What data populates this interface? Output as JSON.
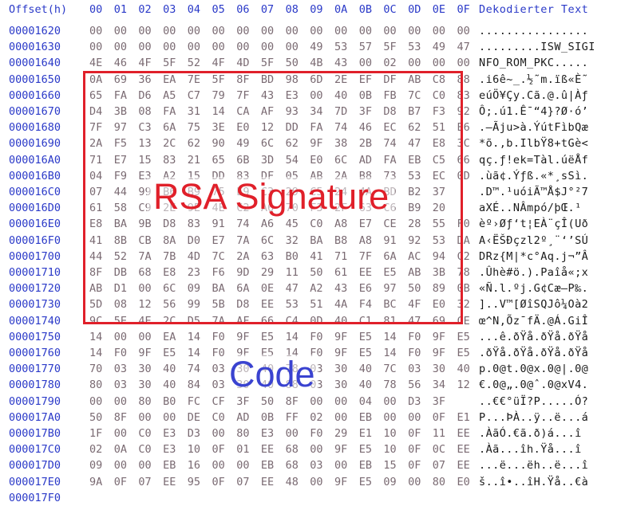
{
  "header": {
    "offset_label": "Offset(h)",
    "columns": [
      "00",
      "01",
      "02",
      "03",
      "04",
      "05",
      "06",
      "07",
      "08",
      "09",
      "0A",
      "0B",
      "0C",
      "0D",
      "0E",
      "0F"
    ],
    "decoded_label": "Dekodierter Text"
  },
  "rows": [
    {
      "offset": "00001620",
      "hex": [
        "00",
        "00",
        "00",
        "00",
        "00",
        "00",
        "00",
        "00",
        "00",
        "00",
        "00",
        "00",
        "00",
        "00",
        "00",
        "00"
      ],
      "ascii": "................"
    },
    {
      "offset": "00001630",
      "hex": [
        "00",
        "00",
        "00",
        "00",
        "00",
        "00",
        "00",
        "00",
        "00",
        "49",
        "53",
        "57",
        "5F",
        "53",
        "49",
        "47",
        "49"
      ],
      "ascii": ".........ISW_SIGI"
    },
    {
      "offset": "00001640",
      "hex": [
        "4E",
        "46",
        "4F",
        "5F",
        "52",
        "4F",
        "4D",
        "5F",
        "50",
        "4B",
        "43",
        "00",
        "02",
        "00",
        "00",
        "00"
      ],
      "ascii": "NFO_ROM_PKC....."
    },
    {
      "offset": "00001650",
      "hex": [
        "0A",
        "69",
        "36",
        "EA",
        "7E",
        "5F",
        "8F",
        "BD",
        "98",
        "6D",
        "2E",
        "EF",
        "DF",
        "AB",
        "C8",
        "88"
      ],
      "ascii": ".i6ê~_.½˜m.ïß«È˜"
    },
    {
      "offset": "00001660",
      "hex": [
        "65",
        "FA",
        "D6",
        "A5",
        "C7",
        "79",
        "7F",
        "43",
        "E3",
        "00",
        "40",
        "0B",
        "FB",
        "7C",
        "C0",
        "83"
      ],
      "ascii": "eúÖ¥Çy.Cã.@.û|Àƒ"
    },
    {
      "offset": "00001670",
      "hex": [
        "D4",
        "3B",
        "08",
        "FA",
        "31",
        "14",
        "CA",
        "AF",
        "93",
        "34",
        "7D",
        "3F",
        "D8",
        "B7",
        "F3",
        "92"
      ],
      "ascii": "Ô;.ú1.Ê¯“4}?Ø·ó’"
    },
    {
      "offset": "00001680",
      "hex": [
        "7F",
        "97",
        "C3",
        "6A",
        "75",
        "3E",
        "E0",
        "12",
        "DD",
        "FA",
        "74",
        "46",
        "EC",
        "62",
        "51",
        "E6"
      ],
      "ascii": ".—Ãju>à.ÝútFìbQæ"
    },
    {
      "offset": "00001690",
      "hex": [
        "2A",
        "F5",
        "13",
        "2C",
        "62",
        "90",
        "49",
        "6C",
        "62",
        "9F",
        "38",
        "2B",
        "74",
        "47",
        "E8",
        "3C"
      ],
      "ascii": "*õ.,b.IlbŸ8+tGè<"
    },
    {
      "offset": "000016A0",
      "hex": [
        "71",
        "E7",
        "15",
        "83",
        "21",
        "65",
        "6B",
        "3D",
        "54",
        "E0",
        "6C",
        "AD",
        "FA",
        "EB",
        "C5",
        "66"
      ],
      "ascii": "qç.ƒ!ek=Tàl.úëÅf"
    },
    {
      "offset": "000016B0",
      "hex": [
        "04",
        "F9",
        "E3",
        "A2",
        "15",
        "DD",
        "83",
        "DF",
        "05",
        "AB",
        "2A",
        "B8",
        "73",
        "53",
        "EC",
        "0D"
      ],
      "ascii": ".ùã¢.Ýƒß.«*¸sSì."
    },
    {
      "offset": "000016C0",
      "hex": [
        "07",
        "44",
        "99",
        "B6",
        "B9",
        "75",
        "E9",
        "C3",
        "29",
        "C5",
        "24",
        "4A",
        "BD",
        "B2",
        "37"
      ],
      "ascii": ".D™.¹uóiÃ™Å$J°²7"
    },
    {
      "offset": "000016D0",
      "hex": [
        "61",
        "58",
        "C9",
        "2E",
        "9E",
        "4E",
        "C2",
        "A6",
        "70",
        "F3",
        "2F",
        "63",
        "C6",
        "B9",
        "20"
      ],
      "ascii": "aXÉ..NÂmpó/þŒ.¹ "
    },
    {
      "offset": "000016E0",
      "hex": [
        "E8",
        "BA",
        "9B",
        "D8",
        "83",
        "91",
        "74",
        "A6",
        "45",
        "C0",
        "A8",
        "E7",
        "CE",
        "28",
        "55",
        "F0"
      ],
      "ascii": "èº›Øƒ‘t¦EÀ¨çÎ(Uð"
    },
    {
      "offset": "000016F0",
      "hex": [
        "41",
        "8B",
        "CB",
        "8A",
        "D0",
        "E7",
        "7A",
        "6C",
        "32",
        "BA",
        "B8",
        "A8",
        "91",
        "92",
        "53",
        "DA"
      ],
      "ascii": "A‹ËŠÐçzl2º¸¨‘’SÚ"
    },
    {
      "offset": "00001700",
      "hex": [
        "44",
        "52",
        "7A",
        "7B",
        "4D",
        "7C",
        "2A",
        "63",
        "B0",
        "41",
        "71",
        "7F",
        "6A",
        "AC",
        "94",
        "C2"
      ],
      "ascii": "DRz{M|*c°Aq.j¬”Â"
    },
    {
      "offset": "00001710",
      "hex": [
        "8F",
        "DB",
        "68",
        "E8",
        "23",
        "F6",
        "9D",
        "29",
        "11",
        "50",
        "61",
        "EE",
        "E5",
        "AB",
        "3B",
        "78"
      ],
      "ascii": ".Ûhè#ö.).Paîå«;x"
    },
    {
      "offset": "00001720",
      "hex": [
        "AB",
        "D1",
        "00",
        "6C",
        "09",
        "BA",
        "6A",
        "0E",
        "47",
        "A2",
        "43",
        "E6",
        "97",
        "50",
        "89",
        "0B"
      ],
      "ascii": "«Ñ.l.ºj.G¢Cæ—P‰."
    },
    {
      "offset": "00001730",
      "hex": [
        "5D",
        "08",
        "12",
        "56",
        "99",
        "5B",
        "D8",
        "EE",
        "53",
        "51",
        "4A",
        "F4",
        "BC",
        "4F",
        "E0",
        "32"
      ],
      "ascii": "]..V™[ØîSQJô¼Oà2"
    },
    {
      "offset": "00001740",
      "hex": [
        "9C",
        "5E",
        "4E",
        "2C",
        "D5",
        "7A",
        "AF",
        "66",
        "C4",
        "0D",
        "40",
        "C1",
        "81",
        "47",
        "69",
        "CE"
      ],
      "ascii": "œ^N,Õz¯fÄ.@Á.GiÎ"
    },
    {
      "offset": "00001750",
      "hex": [
        "14",
        "00",
        "00",
        "EA",
        "14",
        "F0",
        "9F",
        "E5",
        "14",
        "F0",
        "9F",
        "E5",
        "14",
        "F0",
        "9F",
        "E5"
      ],
      "ascii": "...ê.ðŸå.ðŸå.ðŸå"
    },
    {
      "offset": "00001760",
      "hex": [
        "14",
        "F0",
        "9F",
        "E5",
        "14",
        "F0",
        "9F",
        "E5",
        "14",
        "F0",
        "9F",
        "E5",
        "14",
        "F0",
        "9F",
        "E5"
      ],
      "ascii": ".ðŸå.ðŸå.ðŸå.ðŸå"
    },
    {
      "offset": "00001770",
      "hex": [
        "70",
        "03",
        "30",
        "40",
        "74",
        "03",
        "30",
        "40",
        "78",
        "03",
        "30",
        "40",
        "7C",
        "03",
        "30",
        "40"
      ],
      "ascii": "p.0@t.0@x.0@|.0@"
    },
    {
      "offset": "00001780",
      "hex": [
        "80",
        "03",
        "30",
        "40",
        "84",
        "03",
        "30",
        "40",
        "88",
        "03",
        "30",
        "40",
        "78",
        "56",
        "34",
        "12"
      ],
      "ascii": "€.0@„.0@ˆ.0@xV4."
    },
    {
      "offset": "00001790",
      "hex": [
        "00",
        "00",
        "80",
        "B0",
        "FC",
        "CF",
        "3F",
        "50",
        "8F",
        "00",
        "00",
        "04",
        "00",
        "D3",
        "3F"
      ],
      "ascii": "..€€°üÏ?P.....Ó?"
    },
    {
      "offset": "000017A0",
      "hex": [
        "50",
        "8F",
        "00",
        "00",
        "DE",
        "C0",
        "AD",
        "0B",
        "FF",
        "02",
        "00",
        "EB",
        "00",
        "00",
        "0F",
        "E1"
      ],
      "ascii": "P...ÞÀ..ÿ..ë...á"
    },
    {
      "offset": "000017B0",
      "hex": [
        "1F",
        "00",
        "C0",
        "E3",
        "D3",
        "00",
        "80",
        "E3",
        "00",
        "F0",
        "29",
        "E1",
        "10",
        "0F",
        "11",
        "EE"
      ],
      "ascii": ".ÀãÓ.€ã.ð)á...î"
    },
    {
      "offset": "000017C0",
      "hex": [
        "02",
        "0A",
        "C0",
        "E3",
        "10",
        "0F",
        "01",
        "EE",
        "68",
        "00",
        "9F",
        "E5",
        "10",
        "0F",
        "0C",
        "EE"
      ],
      "ascii": ".Àã...îh.Ÿå...î"
    },
    {
      "offset": "000017D0",
      "hex": [
        "09",
        "00",
        "00",
        "EB",
        "16",
        "00",
        "00",
        "EB",
        "68",
        "03",
        "00",
        "EB",
        "15",
        "0F",
        "07",
        "EE"
      ],
      "ascii": "...ë...ëh..ë...î"
    },
    {
      "offset": "000017E0",
      "hex": [
        "9A",
        "0F",
        "07",
        "EE",
        "95",
        "0F",
        "07",
        "EE",
        "48",
        "00",
        "9F",
        "E5",
        "09",
        "00",
        "80",
        "E0"
      ],
      "ascii": "š..î•..îH.Ÿå..€à"
    },
    {
      "offset": "000017F0",
      "hex": [
        "",
        "",
        "",
        "",
        "",
        "",
        "",
        "",
        "",
        "",
        "",
        "",
        "",
        "",
        "",
        ""
      ],
      "ascii": ""
    }
  ],
  "annotations": {
    "signature_label": "RSA Signature",
    "code_label": "Code"
  },
  "colors": {
    "offset_text": "#2a39c8",
    "hex_text": "#7a6a72",
    "ascii_text": "#1a1a1a",
    "signature_box": "#e0202a",
    "code_label": "#3a43d0"
  }
}
